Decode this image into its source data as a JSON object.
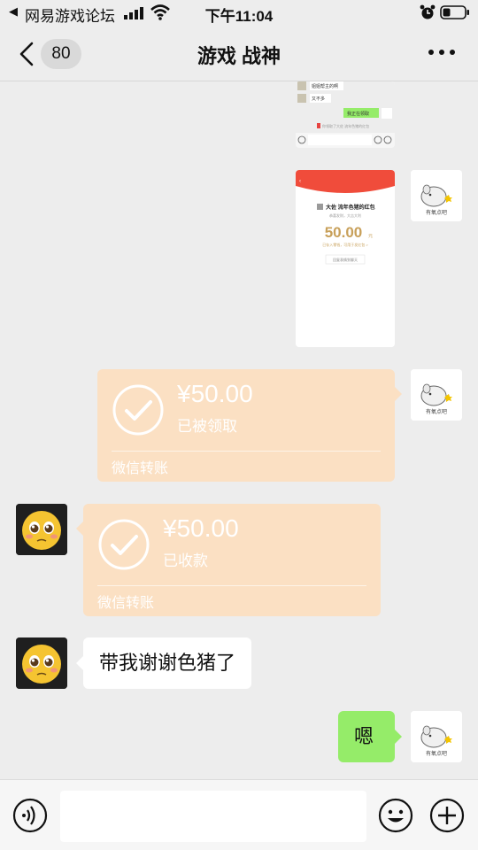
{
  "status_bar": {
    "back_glyph": "◀",
    "app_name": "网易游戏论坛",
    "time": "下午11:04"
  },
  "nav": {
    "unread_count": "80",
    "title": "游戏 战神",
    "more_icon": "more-dots-icon"
  },
  "messages": [
    {
      "type": "screenshot",
      "side": "right",
      "content": "chat-screenshot",
      "texts": [
        "姐姐帮主的啊",
        "又不多",
        "我正在领取",
        "你领取了大佐 流年色猪的红包"
      ]
    },
    {
      "type": "screenshot",
      "side": "right",
      "content": "red-packet-screenshot",
      "texts": [
        "大佐 流年色猪的红包",
        "恭喜发财，大吉大利",
        "50.00",
        "元",
        "已存入零钱，可用于发红包 >",
        "回复表情到聊天"
      ]
    },
    {
      "type": "transfer",
      "side": "right",
      "amount": "¥50.00",
      "status": "已被领取",
      "footer": "微信转账"
    },
    {
      "type": "transfer",
      "side": "left",
      "amount": "¥50.00",
      "status": "已收款",
      "footer": "微信转账"
    },
    {
      "type": "text",
      "side": "left",
      "text": "带我谢谢色猪了"
    },
    {
      "type": "text",
      "side": "right",
      "text": "嗯"
    }
  ],
  "avatar_caption": "有氧点吧",
  "input_bar": {
    "placeholder": "",
    "voice_icon": "voice-icon",
    "emoji_icon": "emoji-icon",
    "plus_icon": "plus-icon"
  },
  "colors": {
    "background": "#ededed",
    "transfer_card": "#fbe0c3",
    "green_bubble": "#95ec69",
    "red_packet": "#f04c3b",
    "amount_gold": "#c8a05a"
  }
}
